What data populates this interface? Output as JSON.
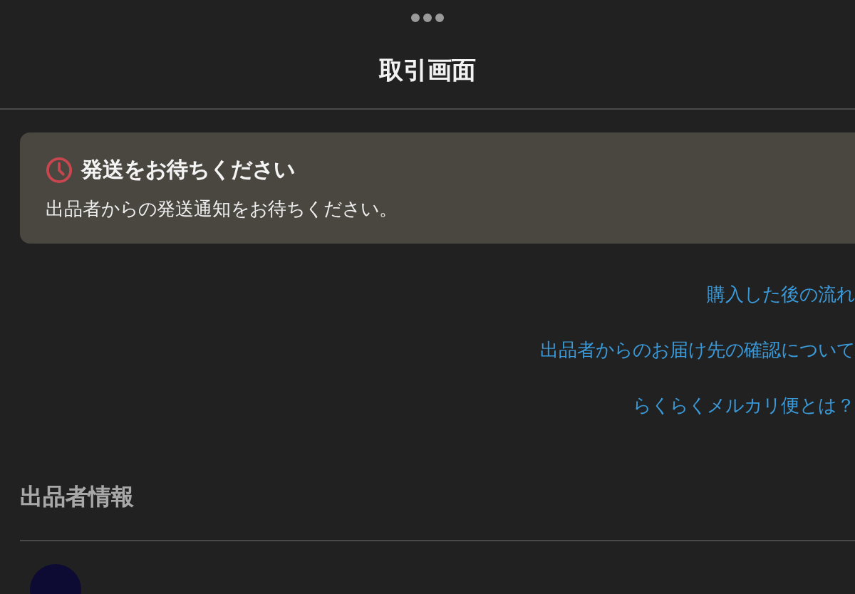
{
  "header": {
    "title": "取引画面"
  },
  "status_card": {
    "title": "発送をお待ちください",
    "message": "出品者からの発送通知をお待ちください。"
  },
  "links": [
    "購入した後の流れ",
    "出品者からのお届け先の確認について",
    "らくらくメルカリ便とは？"
  ],
  "seller_section": {
    "heading": "出品者情報"
  }
}
